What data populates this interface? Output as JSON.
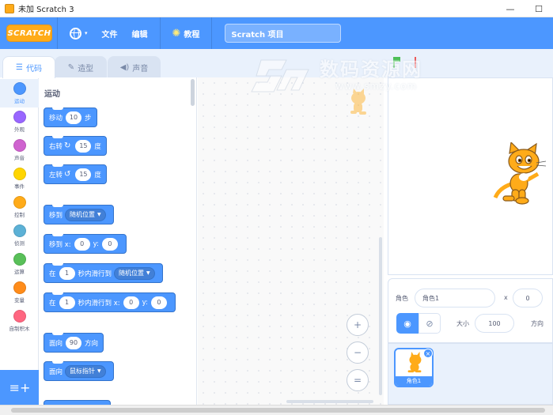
{
  "window": {
    "title": "未加 Scratch 3",
    "minimize": "—",
    "maximize": "☐"
  },
  "menu": {
    "logo": "SCRATCH",
    "language_caret": "▾",
    "file": "文件",
    "edit": "编辑",
    "tutorials": "教程",
    "project_title": "Scratch 项目"
  },
  "tabs": [
    {
      "label": "代码",
      "icon": "code-icon"
    },
    {
      "label": "造型",
      "icon": "brush-icon"
    },
    {
      "label": "声音",
      "icon": "speaker-icon"
    }
  ],
  "categories": [
    {
      "label": "运动",
      "color": "#4c97ff"
    },
    {
      "label": "外观",
      "color": "#9966ff"
    },
    {
      "label": "声音",
      "color": "#cf63cf"
    },
    {
      "label": "事件",
      "color": "#ffd500"
    },
    {
      "label": "控制",
      "color": "#ffab19"
    },
    {
      "label": "侦测",
      "color": "#5cb1d6"
    },
    {
      "label": "运算",
      "color": "#59c059"
    },
    {
      "label": "变量",
      "color": "#ff8c1a"
    },
    {
      "label": "自制积木",
      "color": "#ff6680"
    }
  ],
  "palette": {
    "section": "运动",
    "blocks": {
      "move": {
        "a": "移动",
        "v": "10",
        "b": "步"
      },
      "turn_right": {
        "a": "右转",
        "v": "15",
        "b": "度"
      },
      "turn_left": {
        "a": "左转",
        "v": "15",
        "b": "度"
      },
      "goto": {
        "a": "移到",
        "d": "随机位置"
      },
      "goto_xy": {
        "a": "移到 x:",
        "x": "0",
        "b": "y:",
        "y": "0"
      },
      "glide": {
        "a": "在",
        "v": "1",
        "b": "秒内滑行到",
        "d": "随机位置"
      },
      "glide_xy": {
        "a": "在",
        "v": "1",
        "b": "秒内滑行到 x:",
        "x": "0",
        "c": "y:",
        "y": "0"
      },
      "point_dir": {
        "a": "面向",
        "v": "90",
        "b": "方向"
      },
      "point_towards": {
        "a": "面向",
        "d": "鼠标指针"
      }
    }
  },
  "zoom": {
    "in": "+",
    "out": "−",
    "reset": "="
  },
  "sprite_info": {
    "sprite_label": "角色",
    "sprite_name": "角色1",
    "x_label": "x",
    "x_value": "0",
    "size_label": "大小",
    "size_value": "100",
    "direction_label": "方向"
  },
  "sprite_list": [
    {
      "name": "角色1"
    }
  ],
  "watermark": {
    "big": "数码资源网",
    "small": "www.smzy.com"
  },
  "colors": {
    "accent": "#4c97ff",
    "motion": "#4c97ff",
    "logo": "#ffab19"
  }
}
